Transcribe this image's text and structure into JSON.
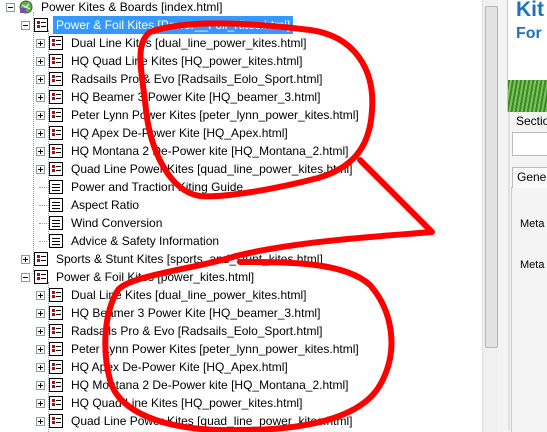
{
  "tree": {
    "items": [
      {
        "label": "Power Kites & Boards [index.html]",
        "icon": "site-icon",
        "expander": "minus",
        "selected": false
      },
      {
        "label": "Power & Foil Kites  [Power__Foil_Kites.html]",
        "icon": "page-icon",
        "expander": "minus",
        "selected": true
      },
      {
        "label": "Dual Line Kites [dual_line_power_kites.html]",
        "icon": "page-icon",
        "expander": "plus",
        "selected": false
      },
      {
        "label": "HQ Quad Line Kites [HQ_power_kites.html]",
        "icon": "page-icon",
        "expander": "plus",
        "selected": false
      },
      {
        "label": "Radsails Pro & Evo [Radsails_Eolo_Sport.html]",
        "icon": "page-icon",
        "expander": "plus",
        "selected": false
      },
      {
        "label": "HQ Beamer 3 Power Kite [HQ_beamer_3.html]",
        "icon": "page-icon",
        "expander": "plus",
        "selected": false
      },
      {
        "label": "Peter Lynn Power Kites [peter_lynn_power_kites.html]",
        "icon": "page-icon",
        "expander": "plus",
        "selected": false
      },
      {
        "label": "HQ Apex De-Power Kite [HQ_Apex.html]",
        "icon": "page-icon",
        "expander": "plus",
        "selected": false
      },
      {
        "label": "HQ Montana 2 De-Power kite [HQ_Montana_2.html]",
        "icon": "page-icon",
        "expander": "plus",
        "selected": false
      },
      {
        "label": "Quad Line Power Kites [quad_line_power_kites.html]",
        "icon": "page-icon",
        "expander": "plus",
        "selected": false
      },
      {
        "label": "Power and Traction Kiting Guide",
        "icon": "document-icon",
        "expander": "none",
        "selected": false
      },
      {
        "label": "Aspect Ratio",
        "icon": "document-icon",
        "expander": "none",
        "selected": false
      },
      {
        "label": "Wind Conversion",
        "icon": "document-icon",
        "expander": "none",
        "selected": false
      },
      {
        "label": "Advice & Safety Information",
        "icon": "document-icon",
        "expander": "none",
        "selected": false
      },
      {
        "label": "Sports & Stunt Kites [sports_and_stunt_kites.html]",
        "icon": "page-icon",
        "expander": "plus",
        "selected": false
      },
      {
        "label": "Power & Foil Kites [power_kites.html]",
        "icon": "page-icon",
        "expander": "minus",
        "selected": false
      },
      {
        "label": "Dual Line Kites [dual_line_power_kites.html]",
        "icon": "page-icon",
        "expander": "plus",
        "selected": false
      },
      {
        "label": "HQ Beamer 3 Power Kite [HQ_beamer_3.html]",
        "icon": "page-icon",
        "expander": "plus",
        "selected": false
      },
      {
        "label": "Radsails Pro & Evo [Radsails_Eolo_Sport.html]",
        "icon": "page-icon",
        "expander": "plus",
        "selected": false
      },
      {
        "label": "Peter Lynn Power Kites [peter_lynn_power_kites.html]",
        "icon": "page-icon",
        "expander": "plus",
        "selected": false
      },
      {
        "label": "HQ Apex De-Power Kite [HQ_Apex.html]",
        "icon": "page-icon",
        "expander": "plus",
        "selected": false
      },
      {
        "label": "HQ Montana 2 De-Power kite [HQ_Montana_2.html]",
        "icon": "page-icon",
        "expander": "plus",
        "selected": false
      },
      {
        "label": "HQ Quad Line Kites [HQ_power_kites.html]",
        "icon": "page-icon",
        "expander": "plus",
        "selected": false
      },
      {
        "label": "Quad Line Power Kites [quad_line_power_kites.html]",
        "icon": "page-icon",
        "expander": "plus",
        "selected": false
      }
    ]
  },
  "right_panel": {
    "banner_line1": "Kit",
    "banner_line2": "For",
    "section_label": "Sectio",
    "tab_label": "Genera",
    "meta1_label": "Meta",
    "meta2_label": "Meta"
  },
  "colors": {
    "selection": "#3399ff",
    "annotation": "#ff0000",
    "brand_blue": "#1e72b8"
  }
}
